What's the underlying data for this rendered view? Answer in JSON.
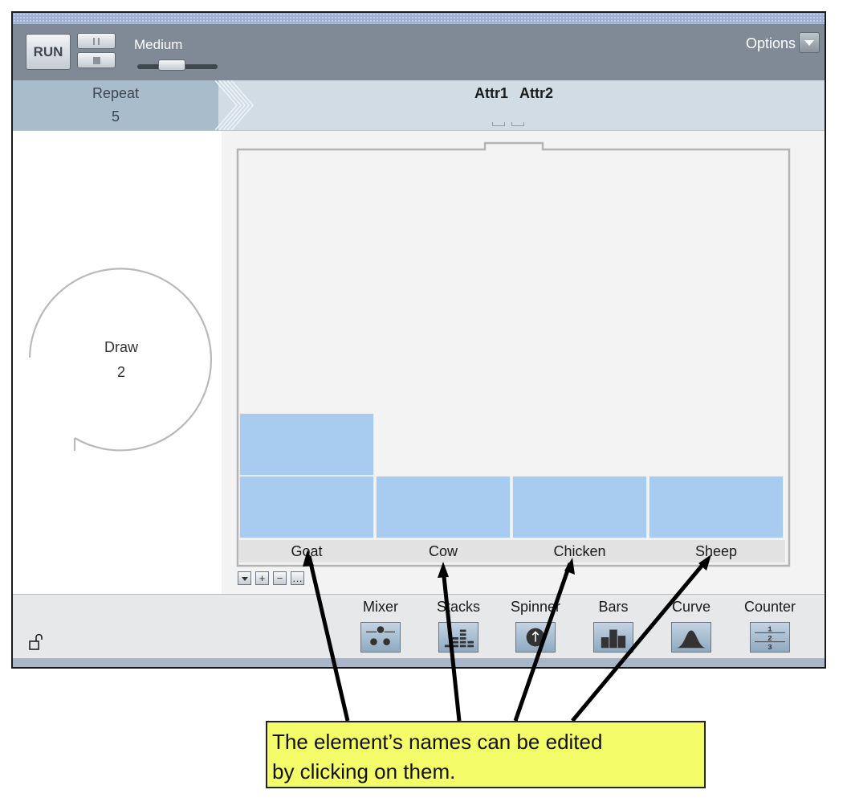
{
  "toolbar": {
    "run_label": "RUN",
    "speed_label": "Medium",
    "speed_level": 0.35,
    "options_label": "Options"
  },
  "attributes": {
    "repeat_label": "Repeat",
    "repeat_value": "5",
    "attr1": "Attr1",
    "attr2": "Attr2"
  },
  "device": {
    "draw_label": "Draw",
    "draw_value": "2",
    "elements": [
      "Goat",
      "Cow",
      "Chicken",
      "Sheep"
    ],
    "element_fill": "#a8cbf0",
    "element_counts": [
      2,
      1,
      1,
      1
    ]
  },
  "devices": {
    "items": [
      {
        "label": "Mixer",
        "icon": "mixer-icon"
      },
      {
        "label": "Stacks",
        "icon": "stacks-icon"
      },
      {
        "label": "Spinner",
        "icon": "spinner-icon"
      },
      {
        "label": "Bars",
        "icon": "bars-icon"
      },
      {
        "label": "Curve",
        "icon": "curve-icon"
      },
      {
        "label": "Counter",
        "icon": "counter-icon"
      }
    ]
  },
  "callout": {
    "line1": "The element’s names can be edited",
    "line2": "by clicking on them."
  },
  "colors": {
    "toolbar_bg": "#7f8a96",
    "callout_bg": "#f4fc6a",
    "element_fill": "#a8cbf0"
  }
}
